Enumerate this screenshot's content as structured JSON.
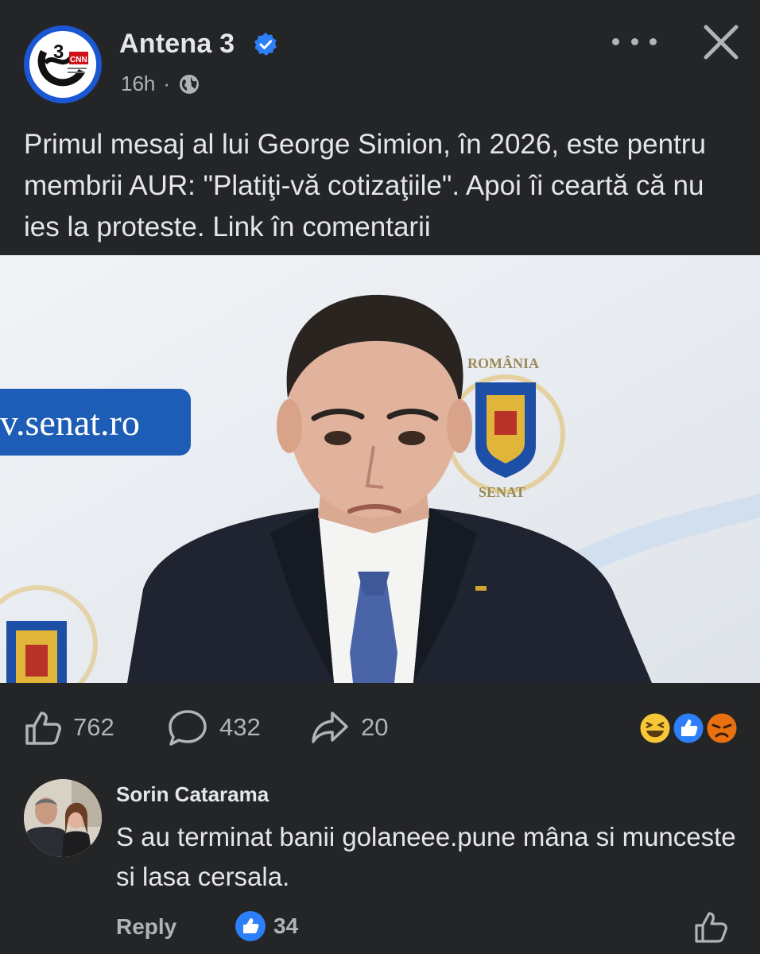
{
  "post": {
    "page_name": "Antena 3",
    "time": "16h",
    "separator": "·",
    "logo_text": "CNN",
    "text": "Primul mesaj al lui George Simion, în 2026, este pentru membrii AUR: \"Platiţi-vă cotizaţiile\". Apoi îi ceartă că nu ies la proteste. Link în comentarii",
    "photo": {
      "banner_text": "v.senat.ro",
      "emblem_top_text": "ROMÂNIA",
      "emblem_bottom_text": "SENAT"
    }
  },
  "stats": {
    "likes": "762",
    "comments": "432",
    "shares": "20",
    "reaction_icons": [
      "haha-icon",
      "like-icon",
      "angry-icon"
    ]
  },
  "comment": {
    "author": "Sorin Catarama",
    "text": "S au terminat banii golaneee.pune mâna si munceste si lasa cersala.",
    "reply_label": "Reply",
    "like_count": "34"
  },
  "colors": {
    "background": "#242526",
    "text": "#e4e6eb",
    "muted": "#b0b3b8",
    "verified": "#2d7ff9"
  }
}
